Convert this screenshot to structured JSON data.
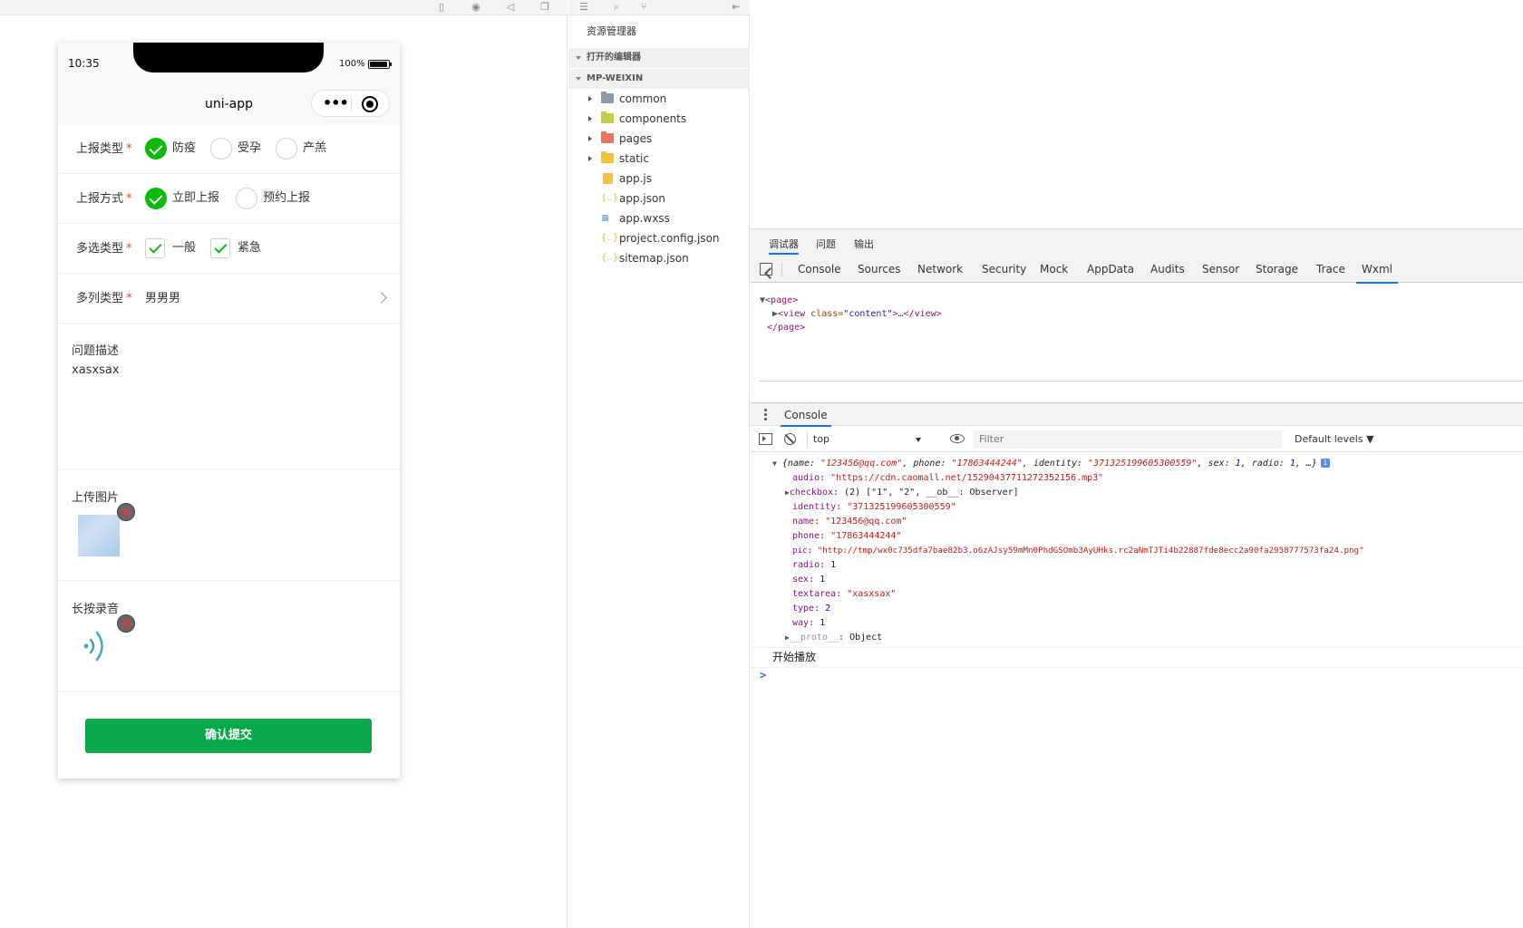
{
  "simulator": {
    "status_bar": {
      "time": "10:35",
      "battery": "100%"
    },
    "nav_title": "uni-app",
    "form": {
      "report_type": {
        "label": "上报类型",
        "required": "*",
        "options": [
          {
            "label": "防疫",
            "selected": true
          },
          {
            "label": "受孕",
            "selected": false
          },
          {
            "label": "产羔",
            "selected": false
          }
        ]
      },
      "report_way": {
        "label": "上报方式",
        "required": "*",
        "options": [
          {
            "label": "立即上报",
            "selected": true
          },
          {
            "label": "预约上报",
            "selected": false
          }
        ]
      },
      "multi_type": {
        "label": "多选类型",
        "required": "*",
        "options": [
          {
            "label": "一般",
            "checked": true
          },
          {
            "label": "紧急",
            "checked": true
          }
        ]
      },
      "multi_column": {
        "label": "多列类型",
        "required": "*",
        "value": "男男男"
      },
      "description": {
        "label": "问题描述",
        "value": "xasxsax"
      },
      "upload": {
        "label": "上传图片"
      },
      "record": {
        "label": "长按录音"
      },
      "submit_label": "确认提交"
    }
  },
  "explorer": {
    "title": "资源管理器",
    "sections": {
      "open_editors": "打开的编辑器",
      "project": "MP-WEIXIN"
    },
    "items": [
      {
        "name": "common",
        "icon": "folder-icon",
        "color": "#8a9aa9",
        "expandable": true
      },
      {
        "name": "components",
        "icon": "folder-icon",
        "color": "#c4cc48",
        "expandable": true
      },
      {
        "name": "pages",
        "icon": "folder-icon",
        "color": "#e8765a",
        "expandable": true
      },
      {
        "name": "static",
        "icon": "folder-icon",
        "color": "#f0c33c",
        "expandable": true
      },
      {
        "name": "app.js",
        "icon": "js-file-icon",
        "expandable": false
      },
      {
        "name": "app.json",
        "icon": "json-file-icon",
        "expandable": false
      },
      {
        "name": "app.wxss",
        "icon": "css-file-icon",
        "expandable": false
      },
      {
        "name": "project.config.json",
        "icon": "json-file-icon",
        "expandable": false
      },
      {
        "name": "sitemap.json",
        "icon": "json-file-icon",
        "expandable": false
      }
    ]
  },
  "devtools": {
    "top_tabs": [
      "调试器",
      "问题",
      "输出"
    ],
    "tabs": [
      "Console",
      "Sources",
      "Network",
      "Security",
      "Mock",
      "AppData",
      "Audits",
      "Sensor",
      "Storage",
      "Trace",
      "Wxml"
    ],
    "active_tab": "Wxml",
    "wxml": {
      "open_tag": "<page>",
      "child_tag": "<view",
      "child_attr": "class=",
      "child_val": "\"content\"",
      "child_rest": ">…</view>",
      "close_tag": "</page>"
    },
    "console": {
      "tab_label": "Console",
      "context": "top",
      "filter_placeholder": "Filter",
      "levels": "Default levels ▼",
      "summary": {
        "p1": "{name: ",
        "v1": "\"123456@qq.com\"",
        "p2": ", phone: ",
        "v2": "\"17863444244\"",
        "p3": ", identity: ",
        "v3": "\"371325199605300559\"",
        "p4": ", sex: ",
        "v4": "1",
        "p5": ", radio: ",
        "v5": "1",
        "p6": ", …}"
      },
      "props": [
        {
          "key": "audio",
          "value": "\"https://cdn.caomall.net/15290437711272352156.mp3\"",
          "kind": "str"
        },
        {
          "key": "checkbox",
          "value": "(2) [\"1\", \"2\", __ob__: Observer]",
          "kind": "plain",
          "expandable": true
        },
        {
          "key": "identity",
          "value": "\"371325199605300559\"",
          "kind": "str"
        },
        {
          "key": "name",
          "value": "\"123456@qq.com\"",
          "kind": "str"
        },
        {
          "key": "phone",
          "value": "\"17863444244\"",
          "kind": "str"
        },
        {
          "key": "pic",
          "value": "\"http://tmp/wx0c735dfa7bae82b3.o6zAJsy59mMn0PhdGSOmb3AyUHks.rc2aNmTJTi4b22887fde8ecc2a90fa2958777573fa24.png\"",
          "kind": "str"
        },
        {
          "key": "radio",
          "value": "1",
          "kind": "num"
        },
        {
          "key": "sex",
          "value": "1",
          "kind": "num"
        },
        {
          "key": "textarea",
          "value": "\"xasxsax\"",
          "kind": "str"
        },
        {
          "key": "type",
          "value": "2",
          "kind": "num"
        },
        {
          "key": "way",
          "value": "1",
          "kind": "num"
        },
        {
          "key": "__proto__",
          "value": "Object",
          "kind": "plain",
          "expandable": true,
          "dim": true
        }
      ],
      "log_text": "开始播放",
      "prompt": ">",
      "info_badge": "i"
    }
  }
}
